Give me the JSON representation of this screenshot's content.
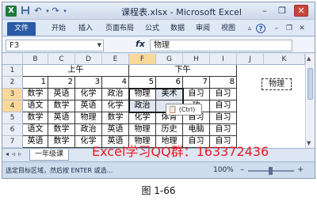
{
  "window": {
    "title": "课程表.xlsx - Microsoft Excel",
    "minimize_icon": "minimize-icon",
    "maximize_icon": "restore-icon",
    "close_icon": "close-icon"
  },
  "qat": {
    "app_icon": "X",
    "save": "save-icon",
    "undo": "undo-icon",
    "redo": "redo-icon"
  },
  "ribbon": {
    "file_tab": "文件",
    "tabs": [
      "开始",
      "插入",
      "页面布局",
      "公式",
      "数据",
      "审阅",
      "视图"
    ],
    "help_icon": "help-icon",
    "file_tab_color": "#2a5aa5"
  },
  "formula_bar": {
    "name_box": "F3",
    "fx": "fx",
    "value": "物理"
  },
  "grid": {
    "columns": [
      "B",
      "C",
      "D",
      "E",
      "F",
      "G",
      "H",
      "I",
      "J",
      "K"
    ],
    "rows": [
      "1",
      "2",
      "3",
      "4",
      "5",
      "6",
      "7"
    ],
    "header_am": "上午",
    "header_pm": "下午",
    "periods": [
      "1",
      "2",
      "3",
      "4",
      "5",
      "6",
      "7",
      "8"
    ],
    "data": [
      [
        "数学",
        "英语",
        "化学",
        "政治",
        "物理",
        "美术",
        "自习",
        "自习"
      ],
      [
        "语文",
        "数学",
        "英语",
        "化学",
        "政治",
        "",
        "",
        "自习"
      ],
      [
        "数学",
        "英语",
        "物理",
        "数学",
        "化学",
        "体育",
        "自习",
        "自习"
      ],
      [
        "语文",
        "数学",
        "政治",
        "英语",
        "物理",
        "历史",
        "电脑",
        "自习"
      ],
      [
        "英语",
        "数学",
        "化学",
        "英语",
        "物理",
        "地理",
        "自习",
        "自习"
      ]
    ],
    "row5_partial": [
      "",
      "",
      "功",
      ""
    ],
    "floating_cell": "物理",
    "paste_tag": "(Ctrl)",
    "paste_icon": "clipboard-icon"
  },
  "sheet_tabs": {
    "active": "一年级课"
  },
  "status_bar": {
    "message": "选定目标区域，然后按 ENTER 或选...",
    "zoom": "100%"
  },
  "watermark": "Excel学习QQ群：163372436",
  "caption": "图 1-66"
}
